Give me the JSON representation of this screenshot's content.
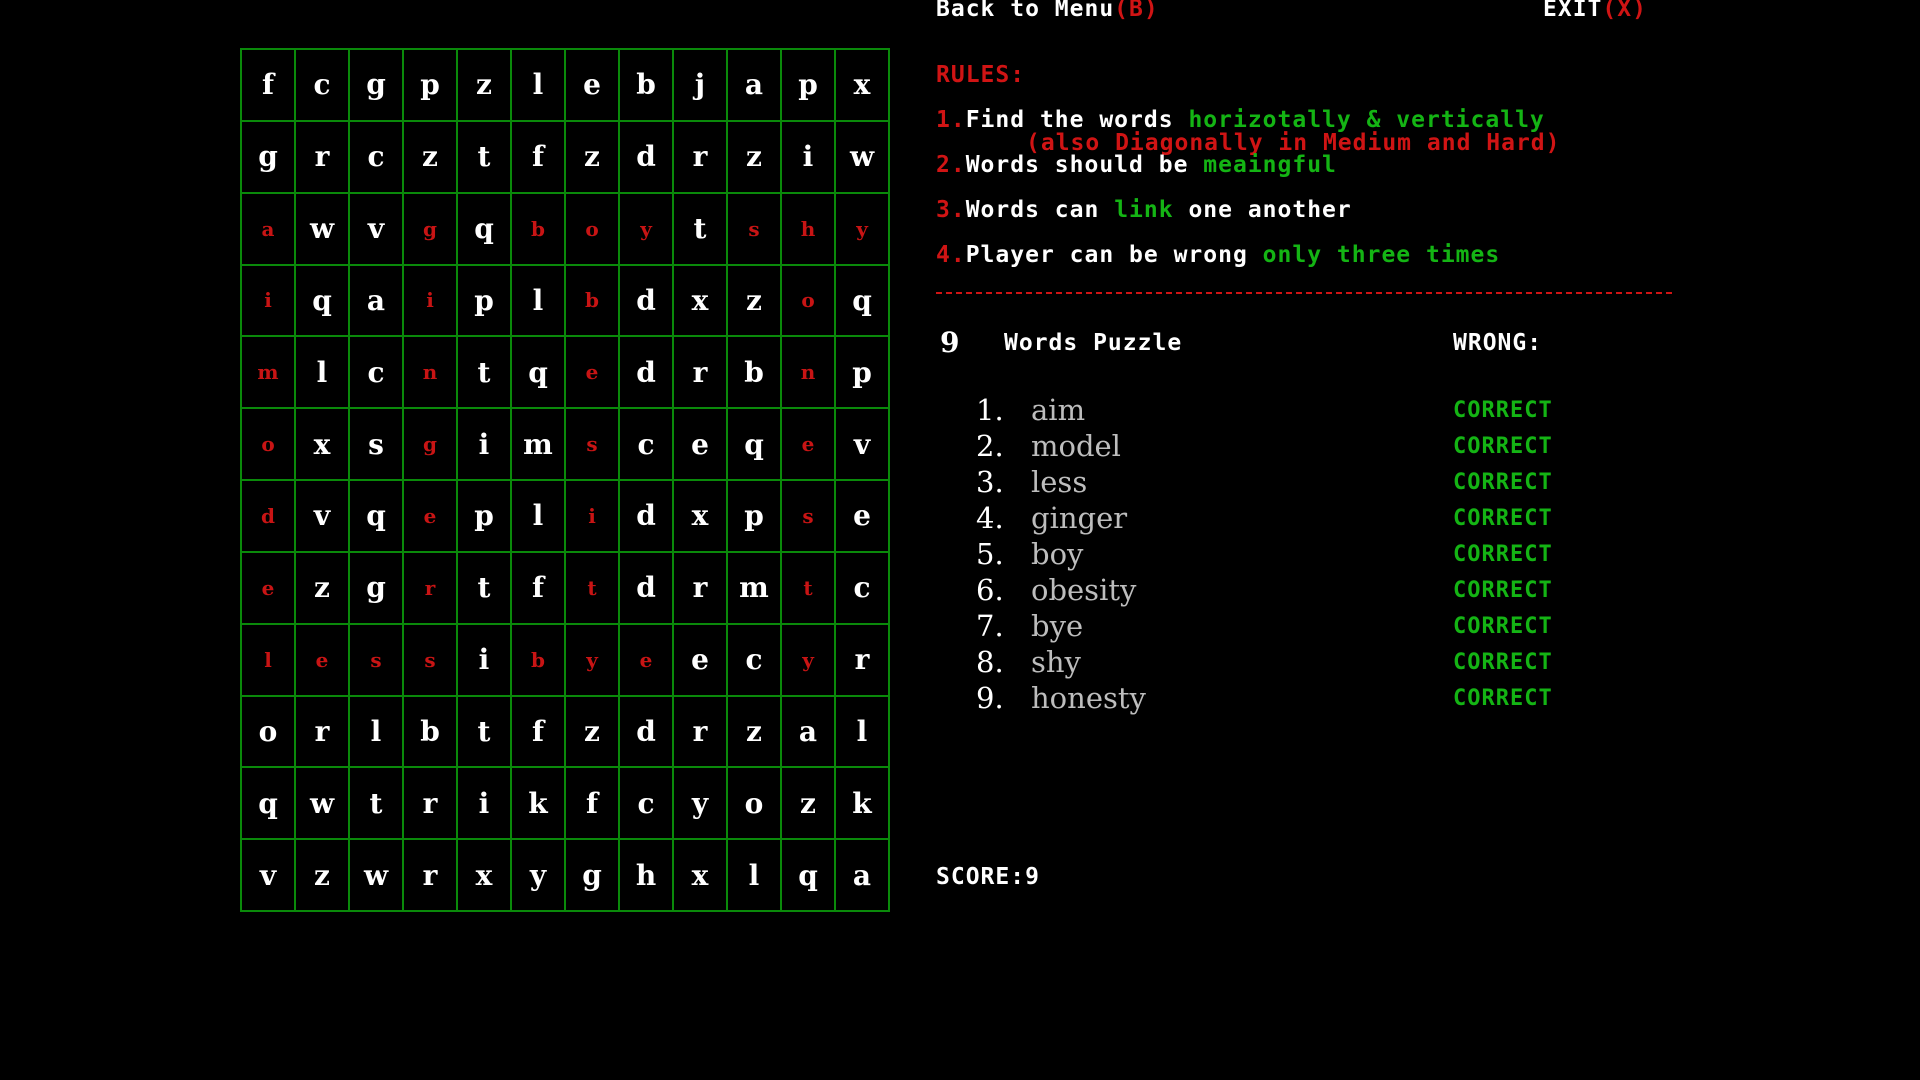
{
  "nav": {
    "back_label": "Back to Menu",
    "back_key": "(B)",
    "exit_label": "EXIT",
    "exit_key": "(X)"
  },
  "rules": {
    "title": "RULES:",
    "items": [
      {
        "num": "1.",
        "text": "Find the words",
        "highlight": "horizotally & vertically",
        "note": "(also Diagonally in Medium and Hard)"
      },
      {
        "num": "2.",
        "text": "Words should be",
        "highlight": "meaingful"
      },
      {
        "num": "3.",
        "text_before": "Words can",
        "highlight": "link",
        "text_after": "one another"
      },
      {
        "num": "4.",
        "text": "Player can be wrong",
        "highlight": "only three times"
      }
    ]
  },
  "puzzle": {
    "count": "9",
    "title": "Words Puzzle",
    "wrong_label": "WRONG:"
  },
  "words": [
    {
      "num": "1.",
      "word": "aim",
      "status": "CORRECT"
    },
    {
      "num": "2.",
      "word": "model",
      "status": "CORRECT"
    },
    {
      "num": "3.",
      "word": "less",
      "status": "CORRECT"
    },
    {
      "num": "4.",
      "word": "ginger",
      "status": "CORRECT"
    },
    {
      "num": "5.",
      "word": "boy",
      "status": "CORRECT"
    },
    {
      "num": "6.",
      "word": "obesity",
      "status": "CORRECT"
    },
    {
      "num": "7.",
      "word": "bye",
      "status": "CORRECT"
    },
    {
      "num": "8.",
      "word": "shy",
      "status": "CORRECT"
    },
    {
      "num": "9.",
      "word": "honesty",
      "status": "CORRECT"
    }
  ],
  "score": {
    "label": "SCORE:",
    "value": "9"
  },
  "grid": [
    [
      "f",
      "c",
      "g",
      "p",
      "z",
      "l",
      "e",
      "b",
      "j",
      "a",
      "p",
      "x"
    ],
    [
      "g",
      "r",
      "c",
      "z",
      "t",
      "f",
      "z",
      "d",
      "r",
      "z",
      "i",
      "w"
    ],
    [
      "a",
      "w",
      "v",
      "g",
      "q",
      "b",
      "o",
      "y",
      "t",
      "s",
      "h",
      "y"
    ],
    [
      "i",
      "q",
      "a",
      "i",
      "p",
      "l",
      "b",
      "d",
      "x",
      "z",
      "o",
      "q"
    ],
    [
      "m",
      "l",
      "c",
      "n",
      "t",
      "q",
      "e",
      "d",
      "r",
      "b",
      "n",
      "p"
    ],
    [
      "o",
      "x",
      "s",
      "g",
      "i",
      "m",
      "s",
      "c",
      "e",
      "q",
      "e",
      "v"
    ],
    [
      "d",
      "v",
      "q",
      "e",
      "p",
      "l",
      "i",
      "d",
      "x",
      "p",
      "s",
      "e"
    ],
    [
      "e",
      "z",
      "g",
      "r",
      "t",
      "f",
      "t",
      "d",
      "r",
      "m",
      "t",
      "c"
    ],
    [
      "l",
      "e",
      "s",
      "s",
      "i",
      "b",
      "y",
      "e",
      "e",
      "c",
      "y",
      "r"
    ],
    [
      "o",
      "r",
      "l",
      "b",
      "t",
      "f",
      "z",
      "d",
      "r",
      "z",
      "a",
      "l"
    ],
    [
      "q",
      "w",
      "t",
      "r",
      "i",
      "k",
      "f",
      "c",
      "y",
      "o",
      "z",
      "k"
    ],
    [
      "v",
      "z",
      "w",
      "r",
      "x",
      "y",
      "g",
      "h",
      "x",
      "l",
      "q",
      "a"
    ]
  ],
  "found_cells": [
    [
      2,
      0
    ],
    [
      3,
      0
    ],
    [
      4,
      0
    ],
    [
      5,
      0
    ],
    [
      6,
      0
    ],
    [
      7,
      0
    ],
    [
      8,
      0
    ],
    [
      2,
      3
    ],
    [
      3,
      3
    ],
    [
      4,
      3
    ],
    [
      5,
      3
    ],
    [
      6,
      3
    ],
    [
      7,
      3
    ],
    [
      2,
      5
    ],
    [
      2,
      6
    ],
    [
      2,
      7
    ],
    [
      3,
      6
    ],
    [
      4,
      6
    ],
    [
      5,
      6
    ],
    [
      6,
      6
    ],
    [
      7,
      6
    ],
    [
      8,
      6
    ],
    [
      2,
      9
    ],
    [
      2,
      10
    ],
    [
      2,
      11
    ],
    [
      3,
      10
    ],
    [
      4,
      10
    ],
    [
      5,
      10
    ],
    [
      6,
      10
    ],
    [
      7,
      10
    ],
    [
      8,
      10
    ],
    [
      8,
      1
    ],
    [
      8,
      2
    ],
    [
      8,
      3
    ],
    [
      8,
      5
    ],
    [
      8,
      7
    ]
  ],
  "colors": {
    "grid_line": "#0a8a0a",
    "found": "#c81414",
    "correct": "#14b414",
    "key": "#d01414"
  }
}
